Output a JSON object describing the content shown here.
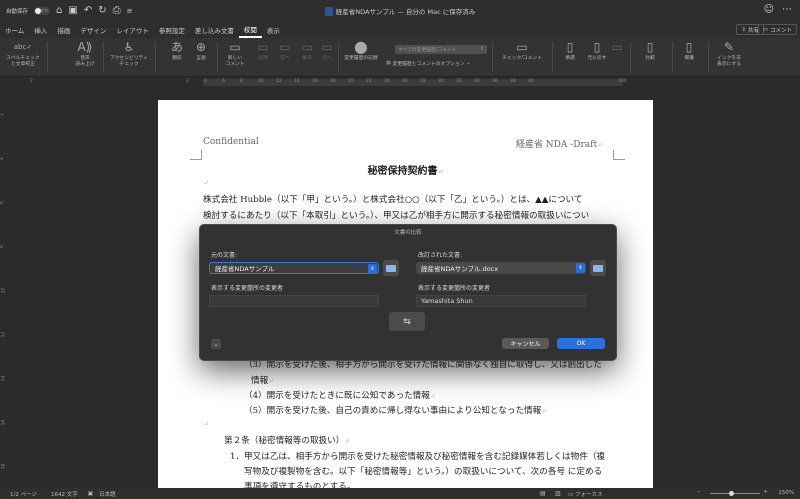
{
  "titlebar": {
    "autosave_label": "自動保存",
    "autosave_state": "オフ",
    "title": "経産省NDAサンプル — 自分の Mac に保存済み"
  },
  "tabs": [
    "ホーム",
    "挿入",
    "描画",
    "デザイン",
    "レイアウト",
    "参照設定",
    "差し込み文書",
    "校閲",
    "表示"
  ],
  "active_tab": "校閲",
  "share_label": "共有",
  "comment_label": "コメント",
  "ribbon": {
    "spell": "スペルチェック\nと文章校正",
    "read_aloud": "音声\n読み上げ",
    "accessibility": "アクセシビリティ\nチェック",
    "translate": "翻訳",
    "language": "言語",
    "new_comment": "新しい\nコメント",
    "delete": "削除",
    "prev": "前へ",
    "resolve": "解決",
    "next": "次へ",
    "track_changes": "変更履歴の記録",
    "markup_select": "すべての変更履歴/コメント",
    "markup_options": "変更履歴とコメントのオプション",
    "check_comments": "チェック/コメント",
    "accept": "承諾",
    "reject": "元に戻す",
    "compare": "比較",
    "protect": "保護",
    "hide_ink": "インクを非\n表示にする"
  },
  "ruler_numbers": [
    "2",
    "2",
    "4",
    "6",
    "8",
    "10",
    "12",
    "14",
    "16",
    "18",
    "20",
    "22",
    "24",
    "26",
    "28",
    "30",
    "32",
    "34",
    "36",
    "38",
    "40",
    "180"
  ],
  "vruler_numbers": [
    "2",
    "4",
    "6",
    "8",
    "10",
    "12",
    "14",
    "16",
    "18"
  ],
  "document": {
    "header_left": "Confidential",
    "header_right": "経産省 NDA -Draft",
    "title": "秘密保持契約書",
    "para1_line1": "株式会社 Hubble（以下「甲」という。）と株式会社○○（以下「乙」という。）とは、▲▲について",
    "para1_line2": "検討するにあたり（以下「本取引」という。）、甲又は乙が相手方に開示する秘密情報の取扱いについ",
    "item3_line1": "（3）開示を受けた後、相手方から開示を受けた情報に関係なく独自に取得し、又は創出した",
    "item3_line2": "情報",
    "item4": "（4）開示を受けたときに既に公知であった情報",
    "item5": "（5）開示を受けた後、自己の責めに帰し得ない事由により公知となった情報",
    "article2": "第２条（秘密情報等の取扱い）",
    "art2_line1": "1．甲又は乙は、相手方から開示を受けた秘密情報及び秘密情報を含む記録媒体若しくは物件（複",
    "art2_line2": "写物及び複製物を含む。以下「秘密情報等」という。）の取扱いについて、次の各号 に定める",
    "art2_line3": "事項を遵守するものとする。"
  },
  "dialog": {
    "title": "文書の比較",
    "original_label": "元の文書:",
    "original_value": "経産省NDAサンプル",
    "revised_label": "改訂された文書:",
    "revised_value": "経産省NDAサンプル.docx",
    "changes_by_label_left": "表示する変更箇所の変更者",
    "changes_by_label_right": "表示する変更箇所の変更者",
    "changes_by_left_value": "",
    "changes_by_right_value": "Yamashita Shun",
    "cancel": "キャンセル",
    "ok": "OK"
  },
  "status": {
    "page": "1/2 ページ",
    "words": "1642 文字",
    "lang": "日本語",
    "focus": "フォーカス",
    "zoom": "150%"
  }
}
